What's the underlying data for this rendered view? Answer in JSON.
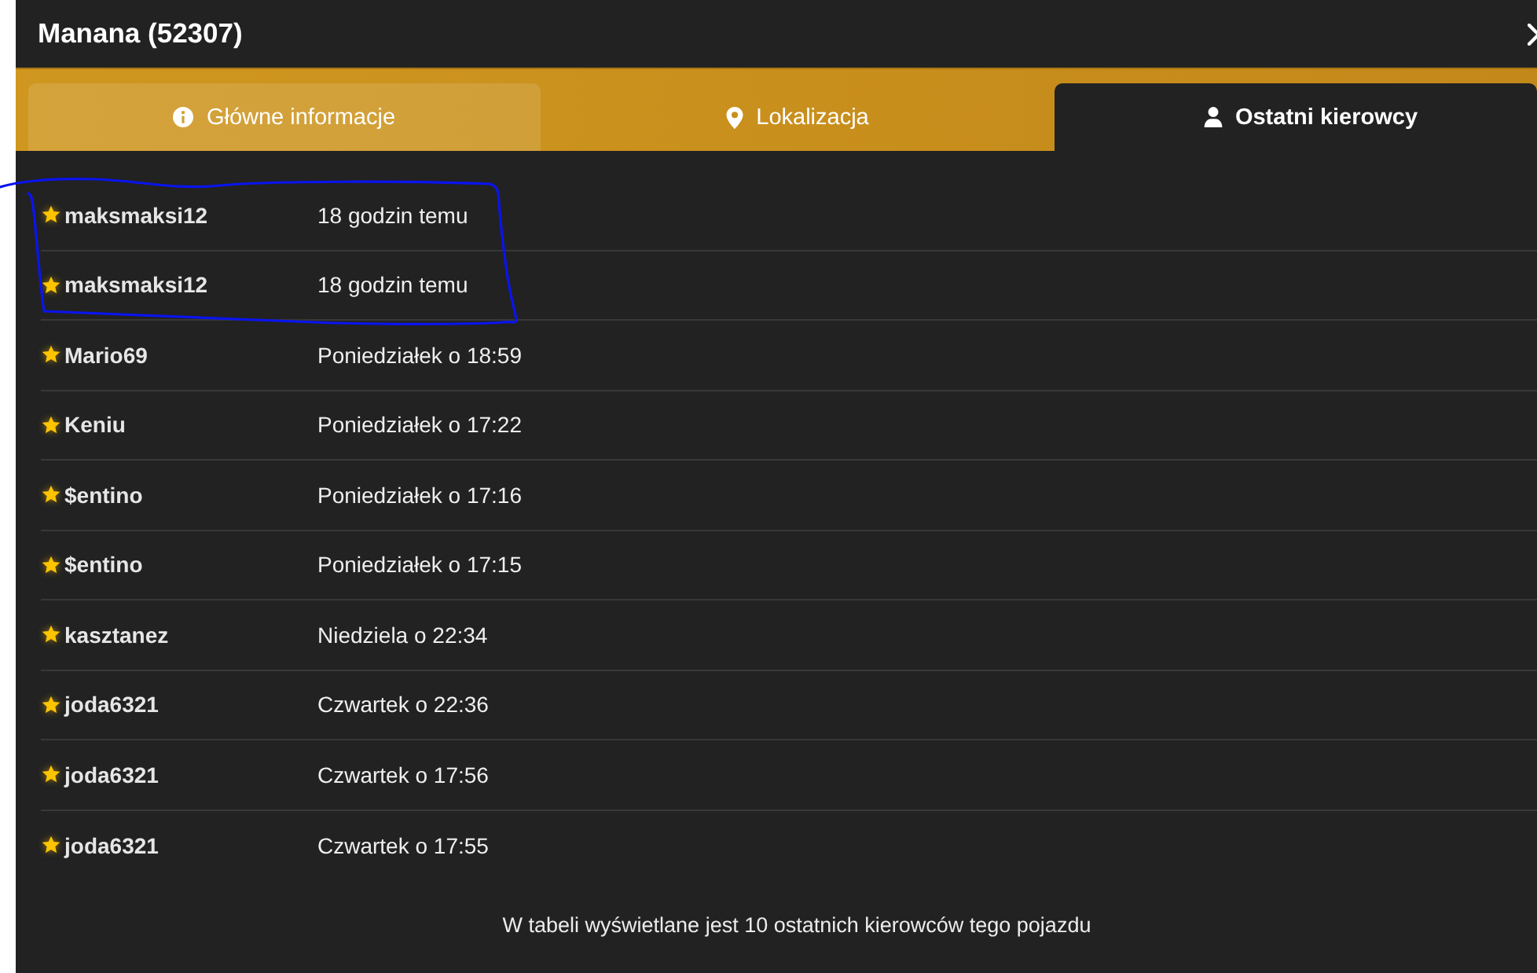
{
  "dialog": {
    "title": "Manana (52307)"
  },
  "tabs": [
    {
      "label": "Główne informacje",
      "kind": "info",
      "selected": false,
      "hovered": true
    },
    {
      "label": "Lokalizacja",
      "kind": "location",
      "selected": false,
      "hovered": false
    },
    {
      "label": "Ostatni kierowcy",
      "kind": "person",
      "selected": true,
      "hovered": false
    }
  ],
  "drivers": [
    {
      "name": "maksmaksi12",
      "time": "18 godzin temu"
    },
    {
      "name": "maksmaksi12",
      "time": "18 godzin temu"
    },
    {
      "name": "Mario69",
      "time": "Poniedziałek o 18:59"
    },
    {
      "name": "Keniu",
      "time": "Poniedziałek o 17:22"
    },
    {
      "name": "$entino",
      "time": "Poniedziałek o 17:16"
    },
    {
      "name": "$entino",
      "time": "Poniedziałek o 17:15"
    },
    {
      "name": "kasztanez",
      "time": "Niedziela o 22:34"
    },
    {
      "name": "joda6321",
      "time": "Czwartek o 22:36"
    },
    {
      "name": "joda6321",
      "time": "Czwartek o 17:56"
    },
    {
      "name": "joda6321",
      "time": "Czwartek o 17:55"
    }
  ],
  "footer": {
    "note": "W tabeli wyświetlane jest 10 ostatnich kierowców tego pojazdu"
  }
}
